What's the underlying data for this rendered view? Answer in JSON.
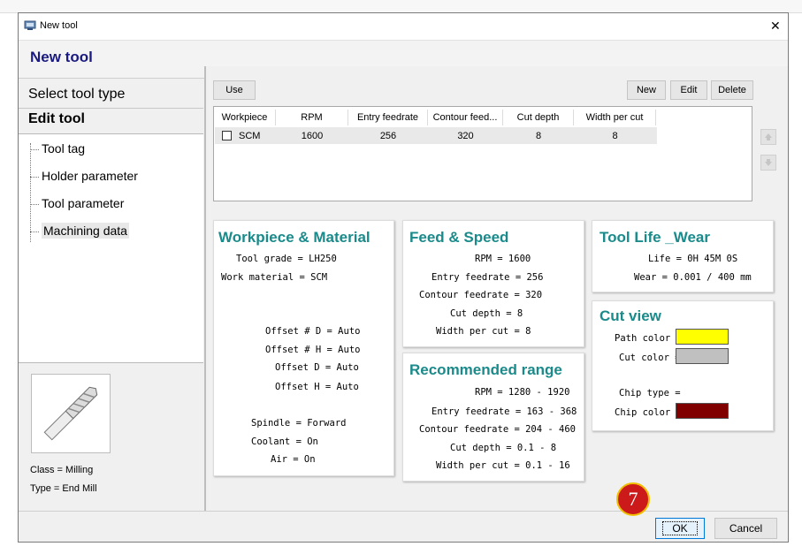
{
  "window": {
    "title": "New tool",
    "close_glyph": "✕"
  },
  "header": {
    "title": "New tool"
  },
  "sidebar": {
    "select_tool_type": "Select tool type",
    "edit_tool": "Edit tool",
    "tree": [
      "Tool tag",
      "Holder parameter",
      "Tool parameter",
      "Machining data"
    ],
    "class_text": "Class = Milling",
    "type_text": "Type = End Mill"
  },
  "toolbar": {
    "use": "Use",
    "new": "New",
    "edit": "Edit",
    "delete": "Delete"
  },
  "table": {
    "columns": [
      "Workpiece",
      "RPM",
      "Entry feedrate",
      "Contour feed...",
      "Cut depth",
      "Width per cut"
    ],
    "rows": [
      {
        "workpiece": "SCM",
        "rpm": "1600",
        "entry": "256",
        "contour": "320",
        "depth": "8",
        "width": "8"
      }
    ]
  },
  "workpiece_card": {
    "title": "Workpiece & Material",
    "tool_grade": "Tool grade = LH250",
    "work_material": "Work material = SCM",
    "offset_no_d": "Offset # D = Auto",
    "offset_no_h": "Offset # H = Auto",
    "offset_d": "Offset D = Auto",
    "offset_h": "Offset H = Auto",
    "spindle": "Spindle = Forward",
    "coolant": "Coolant = On",
    "air": "Air = On"
  },
  "feed_card": {
    "title": "Feed & Speed",
    "rpm": "RPM = 1600",
    "entry": "Entry feedrate = 256",
    "contour": "Contour feedrate = 320",
    "depth": "Cut depth = 8",
    "width": "Width per cut = 8"
  },
  "range_card": {
    "title": "Recommended range",
    "rpm": "RPM = 1280 - 1920",
    "entry": "Entry feedrate = 163 - 368",
    "contour": "Contour feedrate = 204 - 460",
    "depth": "Cut depth = 0.1 - 8",
    "width": "Width per cut = 0.1 - 16"
  },
  "life_card": {
    "title": "Tool Life _Wear",
    "life": "Life = 0H 45M 0S",
    "wear": "Wear = 0.001 / 400 mm"
  },
  "cutview_card": {
    "title": "Cut view",
    "path_color_label": "Path color =",
    "cut_color_label": "Cut color =",
    "chip_type_label": "Chip type =",
    "chip_color_label": "Chip color =",
    "path_color": "#ffff00",
    "cut_color": "#c0c0c0",
    "chip_color": "#800000"
  },
  "footer": {
    "ok": "OK",
    "cancel": "Cancel"
  },
  "step_badge": {
    "number": "7",
    "color": "#cc1a1a"
  },
  "colors": {
    "header_title": "#1a1a80",
    "card_title": "#1a8a8a"
  }
}
